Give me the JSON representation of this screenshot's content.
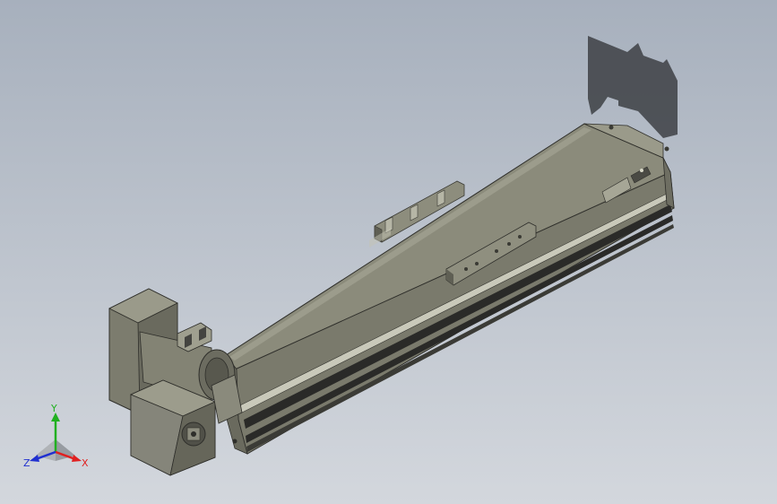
{
  "viewport": {
    "background_top": "#a7b0bd",
    "background_bottom": "#d3d7dd"
  },
  "triad": {
    "x_label": "X",
    "y_label": "Y",
    "z_label": "Z",
    "x_color": "#e02020",
    "y_color": "#20b020",
    "z_color": "#2030d0"
  },
  "model": {
    "body_color": "#8a8a7a",
    "body_dark": "#5a5a50",
    "rail_color": "#2a2a28"
  }
}
